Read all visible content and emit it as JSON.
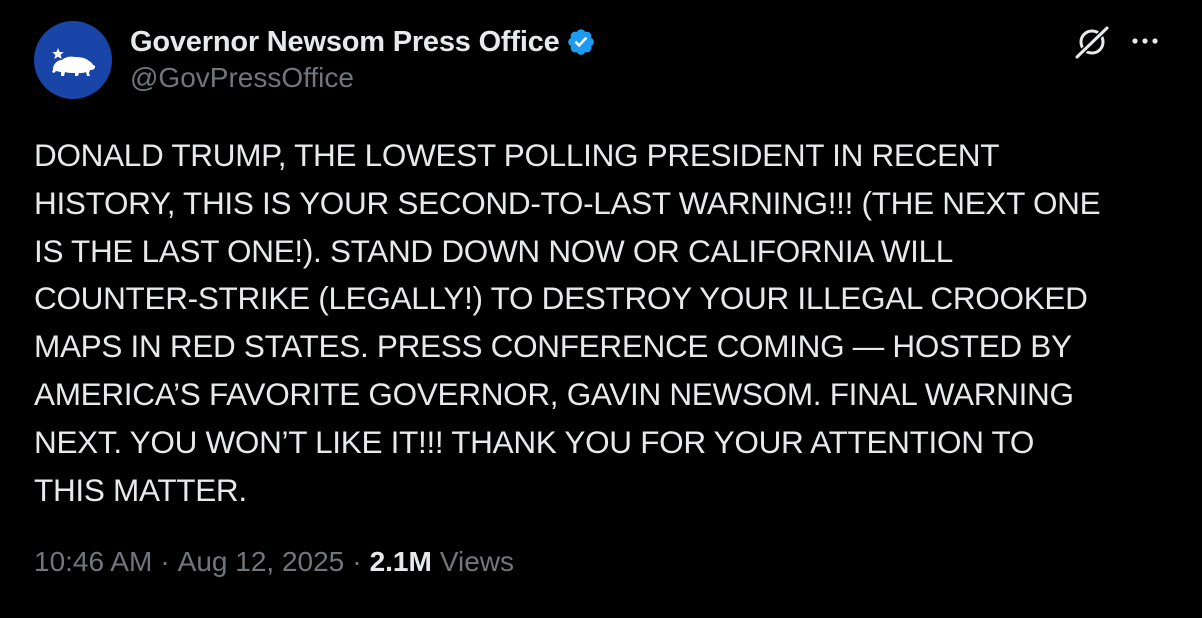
{
  "author": {
    "display_name": "Governor Newsom Press Office",
    "handle": "@GovPressOffice",
    "avatar_icon": "california-bear-star-icon",
    "avatar_color": "#1a45a8",
    "verified_icon": "verified-badge-icon",
    "verified_color": "#1d9bf0"
  },
  "actions": {
    "grok_icon": "grok-icon",
    "more_icon": "more-options-icon"
  },
  "tweet": {
    "text": "DONALD TRUMP, THE LOWEST POLLING PRESIDENT IN RECENT\nHISTORY, THIS IS YOUR SECOND-TO-LAST WARNING!!! (THE NEXT ONE\nIS THE LAST ONE!). STAND DOWN NOW OR CALIFORNIA WILL\nCOUNTER-STRIKE (LEGALLY!) TO DESTROY YOUR ILLEGAL CROOKED\nMAPS IN RED STATES. PRESS CONFERENCE COMING — HOSTED BY\nAMERICA’S FAVORITE GOVERNOR, GAVIN NEWSOM. FINAL WARNING\nNEXT. YOU WON’T LIKE IT!!! THANK YOU FOR YOUR ATTENTION TO\nTHIS MATTER."
  },
  "meta": {
    "time": "10:46 AM",
    "separator": "·",
    "date": "Aug 12, 2025",
    "views_count": "2.1M",
    "views_label": "Views"
  },
  "colors": {
    "background": "#000000",
    "text_primary": "#e7e9ea",
    "text_secondary": "#71767b"
  }
}
